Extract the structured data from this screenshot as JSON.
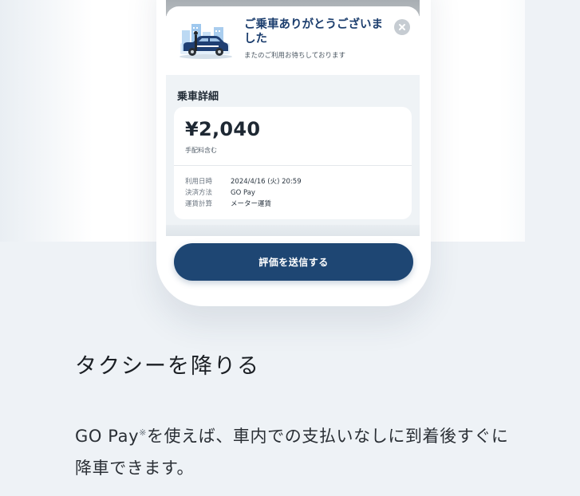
{
  "notice": {
    "title": "ご乗車ありがとうございました",
    "subtitle": "またのご利用お待ちしております",
    "close_icon": "close-icon",
    "illustration_icon": "taxi-city-illustration"
  },
  "detail": {
    "section_title": "乗車詳細",
    "fare": "¥2,040",
    "fare_note": "手配料含む",
    "rows": [
      {
        "label": "利用日時",
        "value": "2024/4/16 (火) 20:59"
      },
      {
        "label": "決済方法",
        "value": "GO Pay"
      },
      {
        "label": "運賃計算",
        "value": "メーター運賃"
      }
    ]
  },
  "actions": {
    "submit_label": "評価を送信する"
  },
  "step": {
    "heading": "タクシーを降りる",
    "desc_prefix": "GO Pay",
    "desc_mark": "※",
    "desc_rest": "を使えば、車内での支払いなしに到着後すぐに降車できます。"
  },
  "colors": {
    "brand_navy": "#1e4673",
    "title_navy": "#1c3e6e",
    "page_bg": "#eef2f6"
  }
}
